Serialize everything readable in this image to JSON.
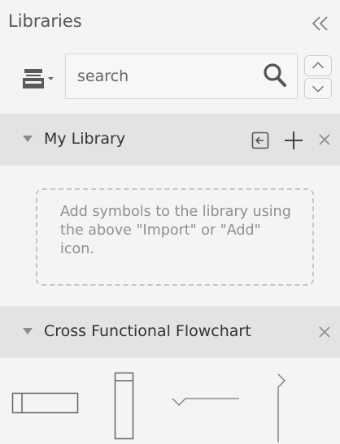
{
  "sidebar": {
    "title": "Libraries",
    "search": {
      "placeholder": "search",
      "value": ""
    }
  },
  "sections": [
    {
      "title": "My Library",
      "empty_message": "Add symbols to the library using the above \"Import\" or \"Add\" icon."
    },
    {
      "title": "Cross Functional Flowchart"
    }
  ],
  "icons": {
    "collapse": "double-chevron-left-icon",
    "library_menu": "library-stack-icon",
    "search": "magnifier-icon",
    "nav_up": "chevron-up-icon",
    "nav_down": "chevron-down-icon",
    "import": "import-icon",
    "add": "plus-icon",
    "close": "close-icon"
  },
  "shapes": [
    {
      "name": "horizontal-pool"
    },
    {
      "name": "vertical-pool"
    },
    {
      "name": "horizontal-separator"
    },
    {
      "name": "vertical-separator"
    }
  ],
  "colors": {
    "panel_background": "#f4f4f4",
    "section_header": "#e3e3e3",
    "icon_gray": "#6d6d6d",
    "placeholder_text": "#8f8f8f"
  }
}
